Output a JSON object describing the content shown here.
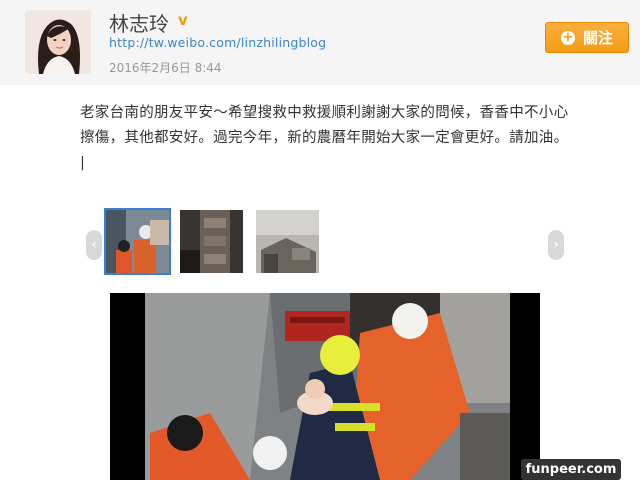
{
  "profile": {
    "name": "林志玲",
    "verified_icon": "verified-v-icon",
    "blog_url": "http://tw.weibo.com/linzhilingblog",
    "date": "2016年2月6日  8:44"
  },
  "follow_button": {
    "label": "關注",
    "icon": "plus-circle-icon"
  },
  "post": {
    "text": "老家台南的朋友平安～希望搜救中救援順利謝謝大家的問候，香香中不小心擦傷，其他都安好。過完今年，新的農曆年開始大家一定會更好。請加油。 |"
  },
  "gallery": {
    "left_arrow": "‹",
    "right_arrow": "›",
    "thumbnails": [
      "rescue-photo-thumb-1",
      "building-collapse-thumb-2",
      "ruins-thumb-3"
    ],
    "active_index": 0
  },
  "watermark": "funpeer.com",
  "colors": {
    "accent_orange": "#f39c14",
    "link_blue": "#3d86c6",
    "active_border": "#3a7fd0"
  }
}
